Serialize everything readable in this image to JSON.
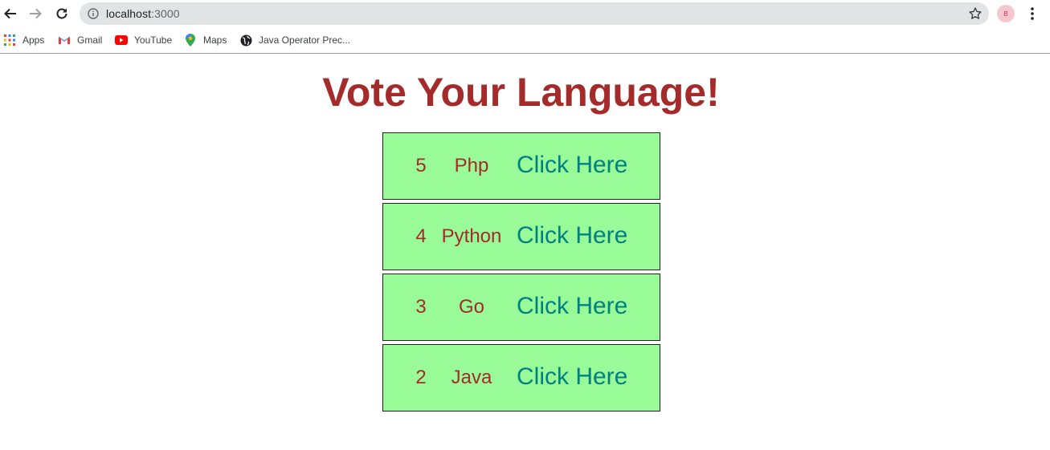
{
  "browser": {
    "url_host": "localhost",
    "url_port": ":3000",
    "profile_initial": "B",
    "bookmarks": [
      {
        "label": "Apps",
        "icon": "apps-grid-icon"
      },
      {
        "label": "Gmail",
        "icon": "gmail-icon"
      },
      {
        "label": "YouTube",
        "icon": "youtube-icon"
      },
      {
        "label": "Maps",
        "icon": "maps-icon"
      },
      {
        "label": "Java Operator Prec...",
        "icon": "globe-icon"
      }
    ]
  },
  "page": {
    "title": "Vote Your Language!",
    "votes": [
      {
        "count": "5",
        "language": "Php",
        "action": "Click Here"
      },
      {
        "count": "4",
        "language": "Python",
        "action": "Click Here"
      },
      {
        "count": "3",
        "language": "Go",
        "action": "Click Here"
      },
      {
        "count": "2",
        "language": "Java",
        "action": "Click Here"
      }
    ]
  },
  "colors": {
    "title": "#a52a2a",
    "row_background": "#98fb98",
    "action_text": "#008080"
  }
}
